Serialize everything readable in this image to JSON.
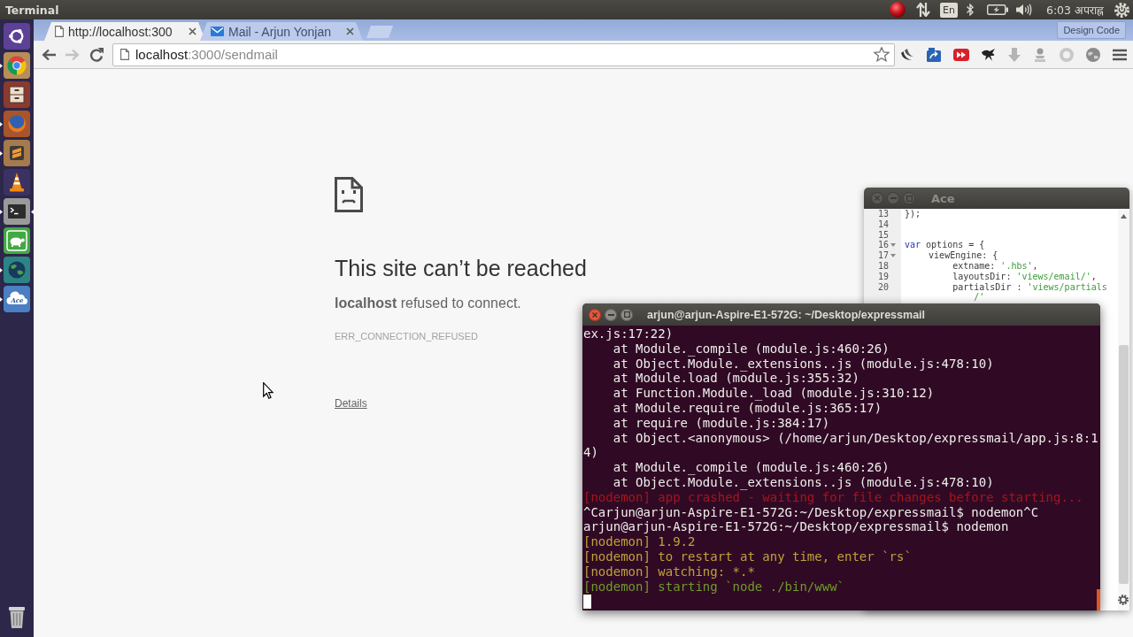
{
  "top_panel": {
    "app_title": "Terminal",
    "keyboard_layout": "En",
    "clock": "6:03 अपराह्न"
  },
  "launcher": [
    {
      "kind": "dash",
      "running": false,
      "focused": false
    },
    {
      "kind": "chrome",
      "running": true,
      "focused": false
    },
    {
      "kind": "files",
      "running": false,
      "focused": false
    },
    {
      "kind": "firefox",
      "running": true,
      "focused": false
    },
    {
      "kind": "sublime",
      "running": true,
      "focused": false
    },
    {
      "kind": "vlc",
      "running": false,
      "focused": false
    },
    {
      "kind": "terminal",
      "running": true,
      "focused": true
    },
    {
      "kind": "turtle",
      "running": false,
      "focused": false
    },
    {
      "kind": "globe",
      "running": true,
      "focused": false
    },
    {
      "kind": "ace",
      "label": "Ace",
      "running": true,
      "focused": false
    },
    {
      "kind": "trash",
      "running": false,
      "focused": false
    }
  ],
  "browser": {
    "tabs": [
      {
        "kind": "page",
        "title": "http://localhost:300",
        "selected": true
      },
      {
        "kind": "mail",
        "title": "Mail - Arjun Yonjan",
        "selected": false
      }
    ],
    "profile_button": "Design Code",
    "nav_buttons": [
      {
        "kind": "back",
        "disabled": false
      },
      {
        "kind": "forward",
        "disabled": true
      },
      {
        "kind": "reload",
        "disabled": false
      }
    ],
    "address_bar": {
      "host": "localhost",
      "path": ":3000/sendmail"
    }
  },
  "error_page": {
    "heading": "This site can’t be reached",
    "message": "**localhost** refused to connect.",
    "error_code": "ERR_CONNECTION_REFUSED",
    "details_link": "Details"
  },
  "ace_window": {
    "title": "Ace",
    "active": false,
    "lines": [
      {
        "number": "13",
        "tokens": [
          {
            "kind": "plain",
            "text": "});"
          }
        ]
      },
      {
        "number": "14"
      },
      {
        "number": "15"
      },
      {
        "number": "16",
        "expanded": true,
        "tokens": [
          {
            "kind": "keyword",
            "text": "var"
          },
          {
            "kind": "plain",
            "text": " options = {"
          }
        ],
        "children": [
          {
            "number": "17",
            "expanded": true,
            "tokens": [
              {
                "kind": "plain",
                "text": "viewEngine: {"
              }
            ],
            "children": [
              {
                "number": "18",
                "tokens": [
                  {
                    "kind": "plain",
                    "text": "extname: "
                  },
                  {
                    "kind": "string",
                    "text": "'.hbs'"
                  },
                  {
                    "kind": "plain",
                    "text": ","
                  }
                ]
              },
              {
                "number": "19",
                "tokens": [
                  {
                    "kind": "plain",
                    "text": "layoutsDir: "
                  },
                  {
                    "kind": "string",
                    "text": "'views/email/'"
                  },
                  {
                    "kind": "plain",
                    "text": ","
                  }
                ]
              },
              {
                "number": "20",
                "tokens": [
                  {
                    "kind": "plain",
                    "text": "partialsDir : "
                  },
                  {
                    "kind": "string",
                    "text": "'views/partials"
                  }
                ],
                "continuation": "/'"
              }
            ]
          }
        ]
      }
    ]
  },
  "terminal_window": {
    "title": "arjun@arjun-Aspire-E1-572G: ~/Desktop/expressmail",
    "active": true,
    "lines": [
      {
        "kind": "output",
        "text": "ex.js:17:22)"
      },
      {
        "kind": "trace",
        "text": "at Module._compile (module.js:460:26)"
      },
      {
        "kind": "trace",
        "text": "at Object.Module._extensions..js (module.js:478:10)"
      },
      {
        "kind": "trace",
        "text": "at Module.load (module.js:355:32)"
      },
      {
        "kind": "trace",
        "text": "at Function.Module._load (module.js:310:12)"
      },
      {
        "kind": "trace",
        "text": "at Module.require (module.js:365:17)"
      },
      {
        "kind": "trace",
        "text": "at require (module.js:384:17)"
      },
      {
        "kind": "trace",
        "text": "at Object.<anonymous> (/home/arjun/Desktop/expressmail/app.js:8:1"
      },
      {
        "kind": "output",
        "text": "4)"
      },
      {
        "kind": "trace",
        "text": "at Module._compile (module.js:460:26)"
      },
      {
        "kind": "trace",
        "text": "at Object.Module._extensions..js (module.js:478:10)"
      },
      {
        "kind": "error",
        "text": "[nodemon] app crashed - waiting for file changes before starting..."
      },
      {
        "kind": "prompt",
        "text": "^Carjun@arjun-Aspire-E1-572G:~/Desktop/expressmail$ nodemon^C"
      },
      {
        "kind": "prompt",
        "text": "arjun@arjun-Aspire-E1-572G:~/Desktop/expressmail$ nodemon"
      },
      {
        "kind": "notice",
        "text": "[nodemon] 1.9.2"
      },
      {
        "kind": "notice",
        "text": "[nodemon] to restart at any time, enter `rs`"
      },
      {
        "kind": "notice",
        "text": "[nodemon] watching: *.*"
      },
      {
        "kind": "start",
        "text": "[nodemon] starting `node ./bin/www`"
      }
    ]
  }
}
